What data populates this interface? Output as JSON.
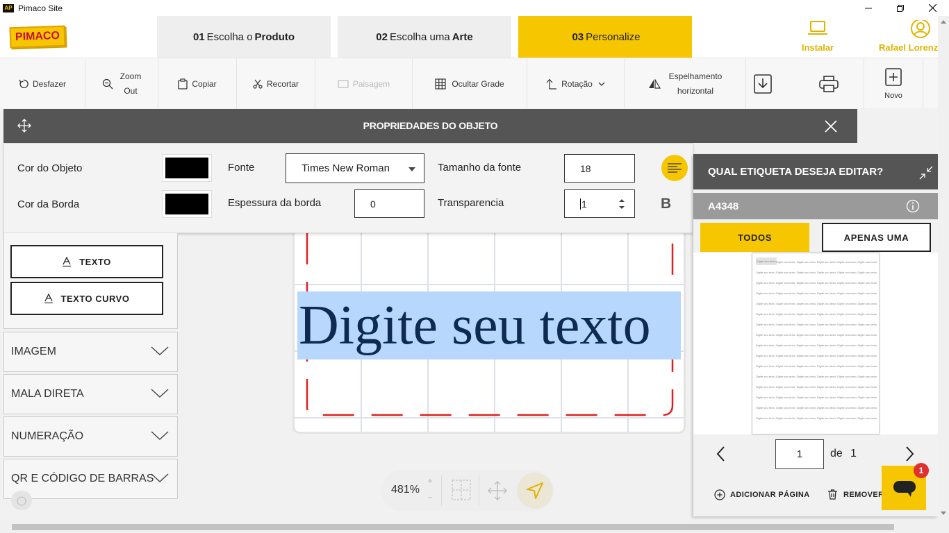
{
  "window": {
    "title": "Pimaco Site",
    "app_icon_text": "AP"
  },
  "header": {
    "logo": "PIMACO",
    "steps": [
      {
        "num": "01",
        "prefix": "Escolha o",
        "bold": "Produto"
      },
      {
        "num": "02",
        "prefix": "Escolha uma",
        "bold": "Arte"
      },
      {
        "num": "03",
        "prefix": "Personalize",
        "bold": ""
      }
    ],
    "install_label": "Instalar",
    "user_label": "Rafael Lorenzoni"
  },
  "toolbar": {
    "undo": "Desfazer",
    "zoom_out_1": "Zoom",
    "zoom_out_2": "Out",
    "copy": "Copiar",
    "cut": "Recortar",
    "landscape": "Paisagem",
    "hide_grid": "Ocultar Grade",
    "rotation": "Rotação",
    "mirror_1": "Espelhamento",
    "mirror_2": "horizontal",
    "new": "Novo"
  },
  "properties": {
    "title": "PROPRIEDADES DO OBJETO",
    "object_color_label": "Cor do Objeto",
    "border_color_label": "Cor da Borda",
    "font_label": "Fonte",
    "font_value": "Times New Roman",
    "border_width_label": "Espessura da borda",
    "border_width_value": "0",
    "font_size_label": "Tamanho da fonte",
    "font_size_value": "18",
    "transparency_label": "Transparencia",
    "transparency_value": "1",
    "bold_label": "B",
    "object_color": "#000000",
    "border_color": "#000000"
  },
  "left_panel": {
    "text_button": "TEXTO",
    "curved_text_button": "TEXTO CURVO",
    "sections": [
      "IMAGEM",
      "MALA DIRETA",
      "NUMERAÇÃO",
      "QR E CÓDIGO DE BARRAS"
    ]
  },
  "canvas": {
    "sample_text": "Digite seu texto"
  },
  "zoom": {
    "level": "481%"
  },
  "right_panel": {
    "title": "QUAL ETIQUETA DESEJA EDITAR?",
    "product_code": "A4348",
    "all_button": "TODOS",
    "one_button": "APENAS UMA",
    "cell_text": "Digite seu texto",
    "page_value": "1",
    "page_of": "de",
    "page_total": "1",
    "add_page": "ADICIONAR PÁGINA",
    "remove": "REMOVER"
  },
  "chat": {
    "badge": "1"
  },
  "colors": {
    "accent": "#f6c700",
    "dark_header": "#555555",
    "guide_red": "#e02020"
  }
}
